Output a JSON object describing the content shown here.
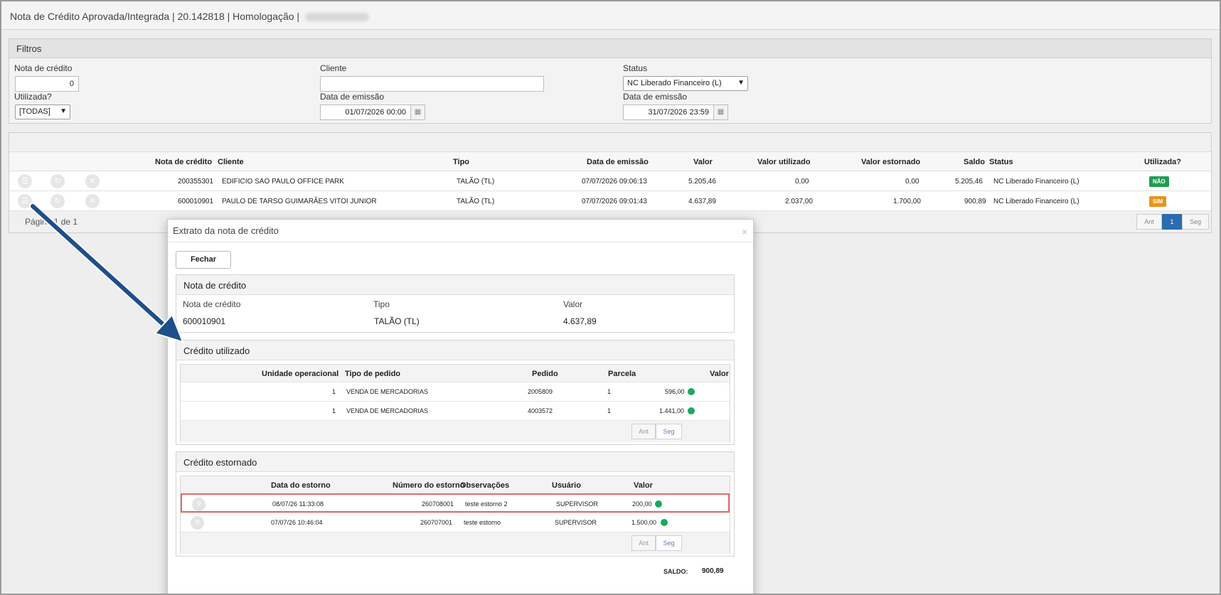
{
  "window": {
    "title": "Nota de Crédito Aprovada/Integrada | 20.142818 | Homologação |"
  },
  "filters": {
    "header": "Filtros",
    "nota_credito_label": "Nota de crédito",
    "nota_credito_value": "0",
    "cliente_label": "Cliente",
    "cliente_value": "",
    "status_label": "Status",
    "status_value": "NC Liberado Financeiro (L)",
    "utilizada_label": "Utilizada?",
    "utilizada_value": "[TODAS]",
    "data_emissao_inicio_label": "Data de emissão",
    "data_emissao_inicio_value": "01/07/2026 00:00",
    "data_emissao_fim_label": "Data de emissão",
    "data_emissao_fim_value": "31/07/2026 23:59"
  },
  "grid": {
    "columns": [
      "Nota de crédito",
      "Cliente",
      "Tipo",
      "Data de emissão",
      "Valor",
      "Valor utilizado",
      "Valor estornado",
      "Saldo",
      "Status",
      "Utilizada?"
    ],
    "rows": [
      {
        "nota": "200355301",
        "cliente": "EDIFICIO SAO PAULO OFFICE PARK",
        "tipo": "TALÃO (TL)",
        "data": "07/07/2026 09:06:13",
        "valor": "5.205,46",
        "utilizado": "0,00",
        "estornado": "0,00",
        "saldo": "5.205,46",
        "status": "NC Liberado Financeiro (L)",
        "utilizada": "NÃO"
      },
      {
        "nota": "600010901",
        "cliente": "PAULO DE TARSO GUIMARÃES VITOI JUNIOR",
        "tipo": "TALÃO (TL)",
        "data": "07/07/2026 09:01:43",
        "valor": "4.637,89",
        "utilizado": "2.037,00",
        "estornado": "1.700,00",
        "saldo": "900,89",
        "status": "NC Liberado Financeiro (L)",
        "utilizada": "SIM"
      }
    ],
    "pagination_text": "Página 1 de 1",
    "pager": {
      "prev": "Ant",
      "current": "1",
      "next": "Seg"
    }
  },
  "modal": {
    "title": "Extrato da nota de crédito",
    "close_glyph": "×",
    "fechar_label": "Fechar",
    "nota_section": {
      "header": "Nota de crédito",
      "labels": [
        "Nota de crédito",
        "Tipo",
        "Valor"
      ],
      "values": [
        "600010901",
        "TALÃO (TL)",
        "4.637,89"
      ]
    },
    "utilizado_section": {
      "header": "Crédito utilizado",
      "columns": [
        "Unidade operacional",
        "Tipo de pedido",
        "Pedido",
        "Parcela",
        "Valor"
      ],
      "rows": [
        {
          "unidade": "1",
          "tipo": "VENDA DE MERCADORIAS",
          "pedido": "2005809",
          "parcela": "1",
          "valor": "596,00"
        },
        {
          "unidade": "1",
          "tipo": "VENDA DE MERCADORIAS",
          "pedido": "4003572",
          "parcela": "1",
          "valor": "1.441,00"
        }
      ],
      "pager": {
        "prev": "Ant",
        "next": "Seg"
      }
    },
    "estornado_section": {
      "header": "Crédito estornado",
      "columns": [
        "Data do estorno",
        "Número do estorno",
        "Observações",
        "Usuário",
        "Valor"
      ],
      "rows": [
        {
          "data": "08/07/26 11:33:08",
          "numero": "260708001",
          "obs": "teste estorno 2",
          "usuario": "SUPERVISOR",
          "valor": "200,00"
        },
        {
          "data": "07/07/26 10:46:04",
          "numero": "260707001",
          "obs": "teste estorno",
          "usuario": "SUPERVISOR",
          "valor": "1.500,00"
        }
      ],
      "pager": {
        "prev": "Ant",
        "next": "Seg"
      }
    },
    "saldo_label": "SALDO:",
    "saldo_value": "900,89"
  },
  "colors": {
    "badge_nao": "#1e9e4f",
    "badge_sim": "#e8951c",
    "status_dot": "#1aa860",
    "pager_active": "#2b6cb0",
    "highlight_row_border": "#e36a6a",
    "arrow": "#1e4e8c"
  },
  "icons": {
    "row_menu": "menu-icon",
    "row_refresh": "refresh-icon",
    "row_cancel": "cancel-icon",
    "calendar": "calendar-icon",
    "search": "magnifier-icon",
    "annotation": "annotation-arrow"
  }
}
